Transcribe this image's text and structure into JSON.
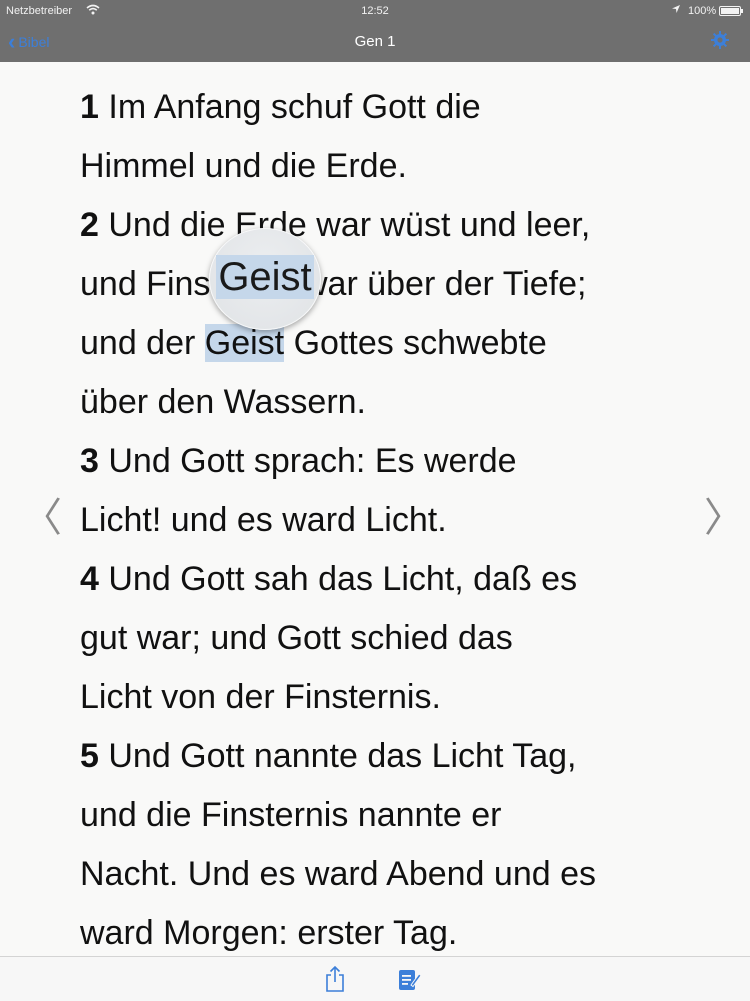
{
  "status_bar": {
    "carrier": "Netzbetreiber",
    "time": "12:52",
    "battery": "100%",
    "icons": [
      "wifi-icon",
      "location-arrow-icon",
      "battery-icon"
    ]
  },
  "nav": {
    "back_label": "Bibel",
    "title": "Gen 1",
    "right_icon": "gear-icon",
    "accent_color": "#3c7fd9"
  },
  "passage": {
    "lines": [
      {
        "num": "1",
        "text": " Im Anfang schuf Gott die"
      },
      {
        "num": "",
        "text": "Himmel und die Erde."
      },
      {
        "num": "2",
        "text": " Und die Erde war wüst und leer,"
      },
      {
        "num": "",
        "text": "und Finsternis war über der Tiefe;"
      },
      {
        "num": "",
        "text": "und der ",
        "hl": "Geist",
        "after": " Gottes schwebte"
      },
      {
        "num": "",
        "text": "über den Wassern."
      },
      {
        "num": "3",
        "text": " Und Gott sprach: Es werde"
      },
      {
        "num": "",
        "text": "Licht! und es ward Licht."
      },
      {
        "num": "4",
        "text": " Und Gott sah das Licht, daß es"
      },
      {
        "num": "",
        "text": "gut war; und Gott schied das"
      },
      {
        "num": "",
        "text": "Licht von der Finsternis."
      },
      {
        "num": "5",
        "text": " Und Gott nannte das Licht Tag,"
      },
      {
        "num": "",
        "text": "und die Finsternis nannte er"
      },
      {
        "num": "",
        "text": "Nacht. Und es ward Abend und es"
      },
      {
        "num": "",
        "text": "ward Morgen: erster Tag."
      }
    ],
    "selected_word": "Geist",
    "highlight_color": "#c5d7ea"
  },
  "loupe": {
    "word": "Geist"
  },
  "page_arrows": {
    "left": "〈",
    "right": "〉"
  },
  "toolbar": {
    "buttons": [
      "share-icon",
      "compose-note-icon"
    ]
  }
}
